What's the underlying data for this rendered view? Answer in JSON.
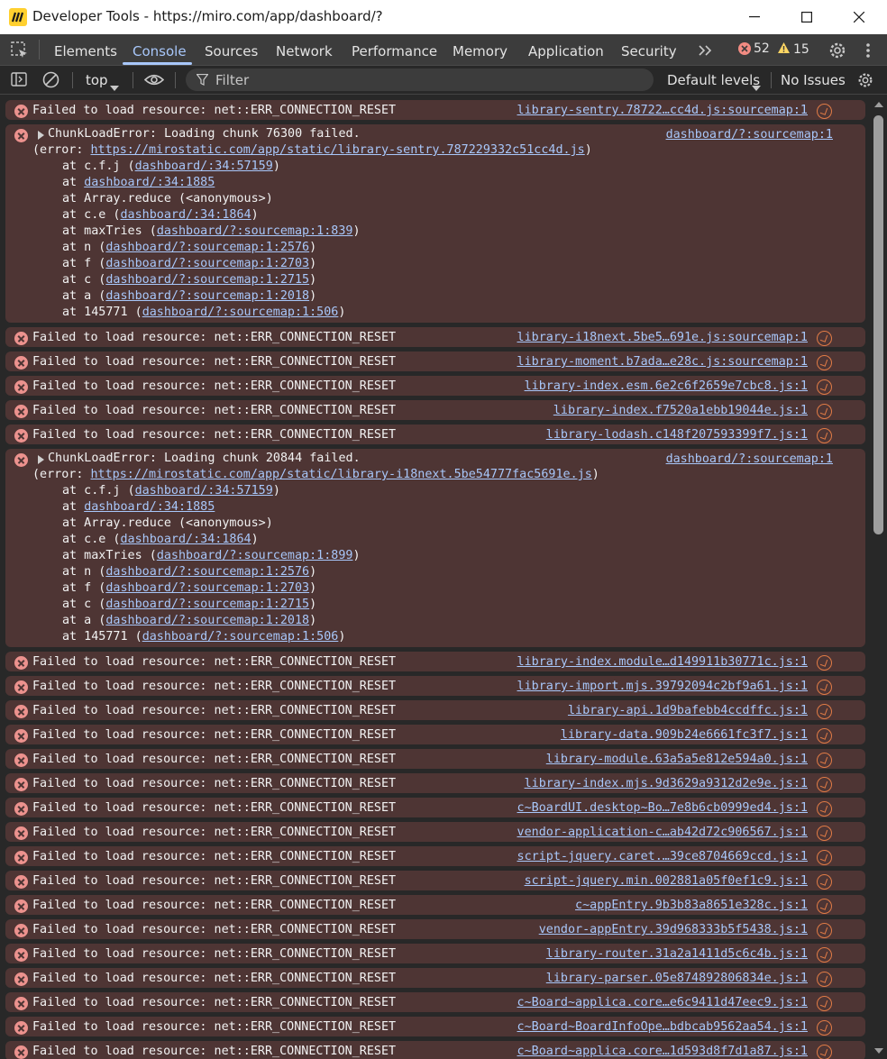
{
  "window": {
    "title": "Developer Tools - https://miro.com/app/dashboard/?"
  },
  "tabs": [
    "Elements",
    "Console",
    "Sources",
    "Network",
    "Performance",
    "Memory",
    "Application",
    "Security"
  ],
  "counters": {
    "errors": "52",
    "warnings": "15"
  },
  "toolbar": {
    "context": "top",
    "filter_placeholder": "Filter",
    "levels": "Default levels",
    "issues": "No Issues"
  },
  "colors": {
    "error_bg": "#4e3534",
    "link": "#a8c7fa",
    "accent": "#a8c7fa"
  },
  "messages": [
    {
      "type": "simple",
      "text": "Failed to load resource: net::ERR_CONNECTION_RESET",
      "source": "library-sentry.78722…cc4d.js:sourcemap:1"
    },
    {
      "type": "chunk",
      "text": "ChunkLoadError: Loading chunk 76300 failed.",
      "source": "dashboard/?:sourcemap:1",
      "error_url": "https://mirostatic.com/app/static/library-sentry.787229332c51cc4d.js",
      "stack": [
        [
          "at c.f.j (",
          "dashboard/:34:57159",
          ")"
        ],
        [
          "at ",
          "dashboard/:34:1885",
          ""
        ],
        [
          "at Array.reduce (<anonymous>)",
          "",
          ""
        ],
        [
          "at c.e (",
          "dashboard/:34:1864",
          ")"
        ],
        [
          "at maxTries (",
          "dashboard/?:sourcemap:1:839",
          ")"
        ],
        [
          "at n (",
          "dashboard/?:sourcemap:1:2576",
          ")"
        ],
        [
          "at f (",
          "dashboard/?:sourcemap:1:2703",
          ")"
        ],
        [
          "at c (",
          "dashboard/?:sourcemap:1:2715",
          ")"
        ],
        [
          "at a (",
          "dashboard/?:sourcemap:1:2018",
          ")"
        ],
        [
          "at 145771 (",
          "dashboard/?:sourcemap:1:506",
          ")"
        ]
      ]
    },
    {
      "type": "simple",
      "text": "Failed to load resource: net::ERR_CONNECTION_RESET",
      "source": "library-i18next.5be5…691e.js:sourcemap:1"
    },
    {
      "type": "simple",
      "text": "Failed to load resource: net::ERR_CONNECTION_RESET",
      "source": "library-moment.b7ada…e28c.js:sourcemap:1"
    },
    {
      "type": "simple",
      "text": "Failed to load resource: net::ERR_CONNECTION_RESET",
      "source": "library-index.esm.6e2c6f2659e7cbc8.js:1"
    },
    {
      "type": "simple",
      "text": "Failed to load resource: net::ERR_CONNECTION_RESET",
      "source": "library-index.f7520a1ebb19044e.js:1"
    },
    {
      "type": "simple",
      "text": "Failed to load resource: net::ERR_CONNECTION_RESET",
      "source": "library-lodash.c148f207593399f7.js:1"
    },
    {
      "type": "chunk",
      "text": "ChunkLoadError: Loading chunk 20844 failed.",
      "source": "dashboard/?:sourcemap:1",
      "error_url": "https://mirostatic.com/app/static/library-i18next.5be54777fac5691e.js",
      "stack": [
        [
          "at c.f.j (",
          "dashboard/:34:57159",
          ")"
        ],
        [
          "at ",
          "dashboard/:34:1885",
          ""
        ],
        [
          "at Array.reduce (<anonymous>)",
          "",
          ""
        ],
        [
          "at c.e (",
          "dashboard/:34:1864",
          ")"
        ],
        [
          "at maxTries (",
          "dashboard/?:sourcemap:1:899",
          ")"
        ],
        [
          "at n (",
          "dashboard/?:sourcemap:1:2576",
          ")"
        ],
        [
          "at f (",
          "dashboard/?:sourcemap:1:2703",
          ")"
        ],
        [
          "at c (",
          "dashboard/?:sourcemap:1:2715",
          ")"
        ],
        [
          "at a (",
          "dashboard/?:sourcemap:1:2018",
          ")"
        ],
        [
          "at 145771 (",
          "dashboard/?:sourcemap:1:506",
          ")"
        ]
      ]
    },
    {
      "type": "simple",
      "text": "Failed to load resource: net::ERR_CONNECTION_RESET",
      "source": "library-index.module…d149911b30771c.js:1"
    },
    {
      "type": "simple",
      "text": "Failed to load resource: net::ERR_CONNECTION_RESET",
      "source": "library-import.mjs.39792094c2bf9a61.js:1"
    },
    {
      "type": "simple",
      "text": "Failed to load resource: net::ERR_CONNECTION_RESET",
      "source": "library-api.1d9bafebb4ccdffc.js:1"
    },
    {
      "type": "simple",
      "text": "Failed to load resource: net::ERR_CONNECTION_RESET",
      "source": "library-data.909b24e6661fc3f7.js:1"
    },
    {
      "type": "simple",
      "text": "Failed to load resource: net::ERR_CONNECTION_RESET",
      "source": "library-module.63a5a5e812e594a0.js:1"
    },
    {
      "type": "simple",
      "text": "Failed to load resource: net::ERR_CONNECTION_RESET",
      "source": "library-index.mjs.9d3629a9312d2e9e.js:1"
    },
    {
      "type": "simple",
      "text": "Failed to load resource: net::ERR_CONNECTION_RESET",
      "source": "c~BoardUI.desktop~Bo…7e8b6cb0999ed4.js:1"
    },
    {
      "type": "simple",
      "text": "Failed to load resource: net::ERR_CONNECTION_RESET",
      "source": "vendor-application-c…ab42d72c906567.js:1"
    },
    {
      "type": "simple",
      "text": "Failed to load resource: net::ERR_CONNECTION_RESET",
      "source": "script-jquery.caret.…39ce8704669ccd.js:1"
    },
    {
      "type": "simple",
      "text": "Failed to load resource: net::ERR_CONNECTION_RESET",
      "source": "script-jquery.min.002881a05f0ef1c9.js:1"
    },
    {
      "type": "simple",
      "text": "Failed to load resource: net::ERR_CONNECTION_RESET",
      "source": "c~appEntry.9b3b83a8651e328c.js:1"
    },
    {
      "type": "simple",
      "text": "Failed to load resource: net::ERR_CONNECTION_RESET",
      "source": "vendor-appEntry.39d968333b5f5438.js:1"
    },
    {
      "type": "simple",
      "text": "Failed to load resource: net::ERR_CONNECTION_RESET",
      "source": "library-router.31a2a1411d5c6c4b.js:1"
    },
    {
      "type": "simple",
      "text": "Failed to load resource: net::ERR_CONNECTION_RESET",
      "source": "library-parser.05e874892806834e.js:1"
    },
    {
      "type": "simple",
      "text": "Failed to load resource: net::ERR_CONNECTION_RESET",
      "source": "c~Board~applica.core…e6c9411d47eec9.js:1"
    },
    {
      "type": "simple",
      "text": "Failed to load resource: net::ERR_CONNECTION_RESET",
      "source": "c~Board~BoardInfoOpe…bdbcab9562aa54.js:1"
    },
    {
      "type": "simple",
      "text": "Failed to load resource: net::ERR_CONNECTION_RESET",
      "source": "c~Board~applica.core…1d593d8f7d1a87.js:1"
    }
  ]
}
